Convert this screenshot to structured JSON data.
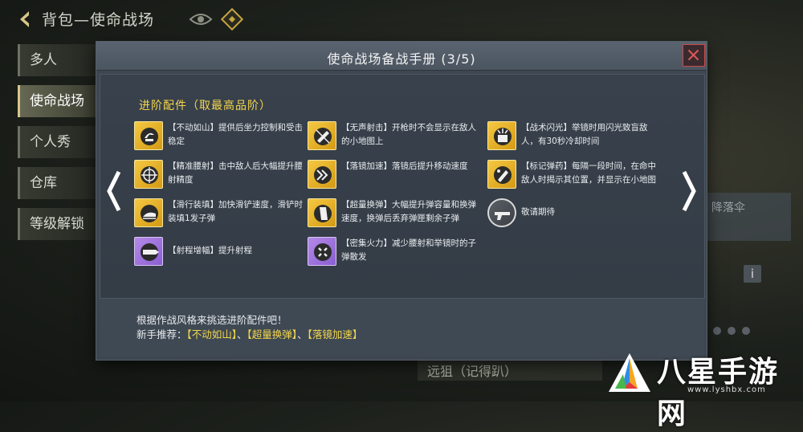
{
  "header": {
    "title": "背包—使命战场"
  },
  "sidebar": {
    "items": [
      {
        "label": "多人"
      },
      {
        "label": "使命战场"
      },
      {
        "label": "个人秀"
      },
      {
        "label": "仓库"
      },
      {
        "label": "等级解锁"
      }
    ]
  },
  "background": {
    "right_panel_text": "降落伞",
    "bottom_text": "远狙（记得趴）",
    "info_icon": "i"
  },
  "modal": {
    "title": "使命战场备战手册 (3/5)",
    "section_title": "进阶配件（取最高品阶）",
    "perks": [
      {
        "text": "【不动如山】提供后坐力控制和受击稳定",
        "icon": "steady-icon",
        "tier": "gold"
      },
      {
        "text": "【无声射击】开枪时不会显示在敌人的小地图上",
        "icon": "silencer-icon",
        "tier": "gold"
      },
      {
        "text": "【战术闪光】举镜时用闪光致盲敌人，有30秒冷却时间",
        "icon": "flash-icon",
        "tier": "gold"
      },
      {
        "text": "【精准腰射】击中敌人后大幅提升腰射精度",
        "icon": "crosshair-icon",
        "tier": "gold"
      },
      {
        "text": "【落镜加速】落镜后提升移动速度",
        "icon": "speed-icon",
        "tier": "gold"
      },
      {
        "text": "【标记弹药】每隔一段时间，在命中敌人时揭示其位置，并显示在小地图",
        "icon": "mark-ammo-icon",
        "tier": "gold"
      },
      {
        "text": "【滑行装填】加快滑铲速度，滑铲时装填1发子弹",
        "icon": "slide-icon",
        "tier": "gold"
      },
      {
        "text": "【超量换弹】大幅提升弹容量和换弹速度，换弹后丢弃弹匣剩余子弹",
        "icon": "magazine-icon",
        "tier": "gold"
      },
      {
        "text": "敬请期待",
        "icon": "gun-icon",
        "tier": "grey"
      },
      {
        "text": "【射程增幅】提升射程",
        "icon": "range-icon",
        "tier": "purple"
      },
      {
        "text": "【密集火力】减少腰射和举镜时的子弹散发",
        "icon": "spread-icon",
        "tier": "purple"
      }
    ],
    "footer": {
      "line1": "根据作战风格来挑选进阶配件吧！",
      "line2_prefix": "新手推荐：",
      "rec1": "【不动如山】",
      "sep1": "、",
      "rec2": "【超量换弹】",
      "sep2": "、",
      "rec3": "【落镜加速】"
    }
  },
  "watermark": {
    "text": "八星手游网",
    "url": "www.lyshbx.com"
  },
  "colors": {
    "accent_yellow": "#f3d64c",
    "gold_icon": "#f5c842",
    "purple_icon": "#a57ade",
    "close_red": "#c84a4a"
  }
}
